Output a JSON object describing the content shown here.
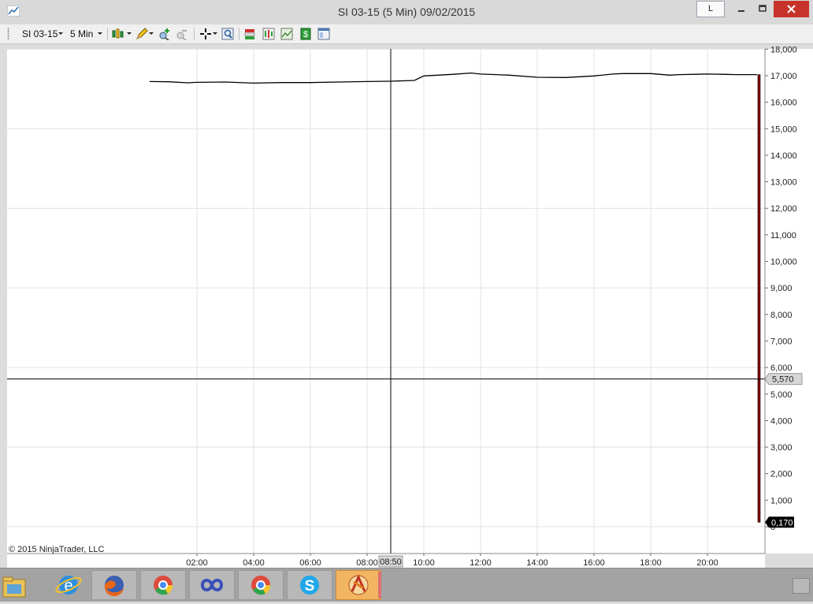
{
  "window": {
    "title": "SI 03-15 (5 Min)  09/02/2015",
    "link_button_label": "L"
  },
  "toolbar": {
    "instrument": "SI 03-15",
    "interval": "5 Min"
  },
  "chart_data": {
    "type": "line",
    "series": [
      {
        "x": [
          "00:20",
          "01:00",
          "01:40",
          "02:00",
          "03:00",
          "04:00",
          "05:00",
          "06:00",
          "07:00",
          "08:00",
          "08:50",
          "09:40",
          "10:00",
          "11:00",
          "11:40",
          "12:00",
          "13:00",
          "14:00",
          "15:00",
          "16:00",
          "16:40",
          "17:00",
          "18:00",
          "18:40",
          "19:00",
          "20:00",
          "20:40",
          "21:00",
          "21:40",
          "21:45",
          "21:50"
        ],
        "y": [
          16.78,
          16.77,
          16.73,
          16.75,
          16.76,
          16.72,
          16.74,
          16.74,
          16.76,
          16.78,
          16.79,
          16.82,
          16.99,
          17.05,
          17.1,
          17.06,
          17.02,
          16.94,
          16.93,
          16.99,
          17.06,
          17.08,
          17.08,
          17.02,
          17.04,
          17.06,
          17.05,
          17.04,
          17.04,
          17.04,
          0.17
        ],
        "color": "#000000"
      }
    ],
    "xticks": [
      "02:00",
      "04:00",
      "06:00",
      "08:00",
      "10:00",
      "12:00",
      "14:00",
      "16:00",
      "18:00",
      "20:00"
    ],
    "yticks": [
      "0",
      "1,000",
      "2,000",
      "3,000",
      "4,000",
      "5,000",
      "6,000",
      "7,000",
      "8,000",
      "9,000",
      "10,000",
      "11,000",
      "12,000",
      "13,000",
      "14,000",
      "15,000",
      "16,000",
      "17,000",
      "18,000"
    ],
    "ylim": [
      0,
      18
    ],
    "grid": true,
    "crosshair": {
      "x_label": "08:50",
      "y_label": "5,570"
    },
    "last_price_label": "0,170",
    "watermark": "© 2015 NinjaTrader, LLC"
  },
  "taskbar": {
    "items": [
      {
        "icon": "file-explorer-icon"
      },
      {
        "icon": "internet-explorer-icon"
      },
      {
        "icon": "firefox-icon"
      },
      {
        "icon": "chrome-icon"
      },
      {
        "icon": "infinity-app-icon"
      },
      {
        "icon": "chrome-icon"
      },
      {
        "icon": "skype-icon"
      },
      {
        "icon": "ninjatrader-icon"
      }
    ]
  },
  "colors": {
    "close_button": "#c7332b",
    "last_bar": "#8b0000",
    "active_task": "#f2b562"
  }
}
